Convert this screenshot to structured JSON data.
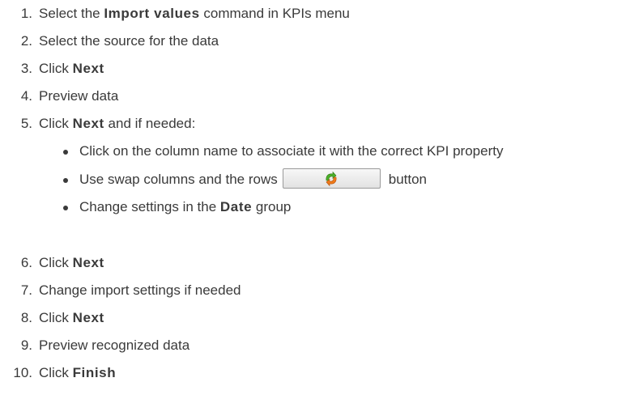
{
  "steps": [
    {
      "num": "1.",
      "pre": "Select the ",
      "bold": "Import values",
      "post": " command in KPIs menu"
    },
    {
      "num": "2.",
      "pre": "Select the source for the data",
      "bold": "",
      "post": ""
    },
    {
      "num": "3.",
      "pre": "Click ",
      "bold": "Next",
      "post": ""
    },
    {
      "num": "4.",
      "pre": "Preview data",
      "bold": "",
      "post": ""
    },
    {
      "num": "5.",
      "pre": "Click ",
      "bold": "Next",
      "post": " and if needed:"
    },
    {
      "num": "6.",
      "pre": "Click ",
      "bold": "Next",
      "post": ""
    },
    {
      "num": "7.",
      "pre": "Change import settings if needed",
      "bold": "",
      "post": ""
    },
    {
      "num": "8.",
      "pre": "Click ",
      "bold": "Next",
      "post": ""
    },
    {
      "num": "9.",
      "pre": "Preview recognized data",
      "bold": "",
      "post": ""
    },
    {
      "num": "10.",
      "pre": "Click ",
      "bold": "Finish",
      "post": ""
    }
  ],
  "substeps": [
    {
      "pre": "Click on the column name to associate it with the correct KPI property",
      "bold": "",
      "post": ""
    },
    {
      "pre": "Use swap columns and the rows",
      "bold": "",
      "post": "button"
    },
    {
      "pre": "Change settings in the ",
      "bold": "Date",
      "post": " group"
    }
  ],
  "icons": {
    "swap_button_icon": "swap-arrows-icon"
  },
  "colors": {
    "text": "#3a3a3a",
    "swap_icon_green": "#4caf2a",
    "swap_icon_orange": "#f07a1a"
  }
}
